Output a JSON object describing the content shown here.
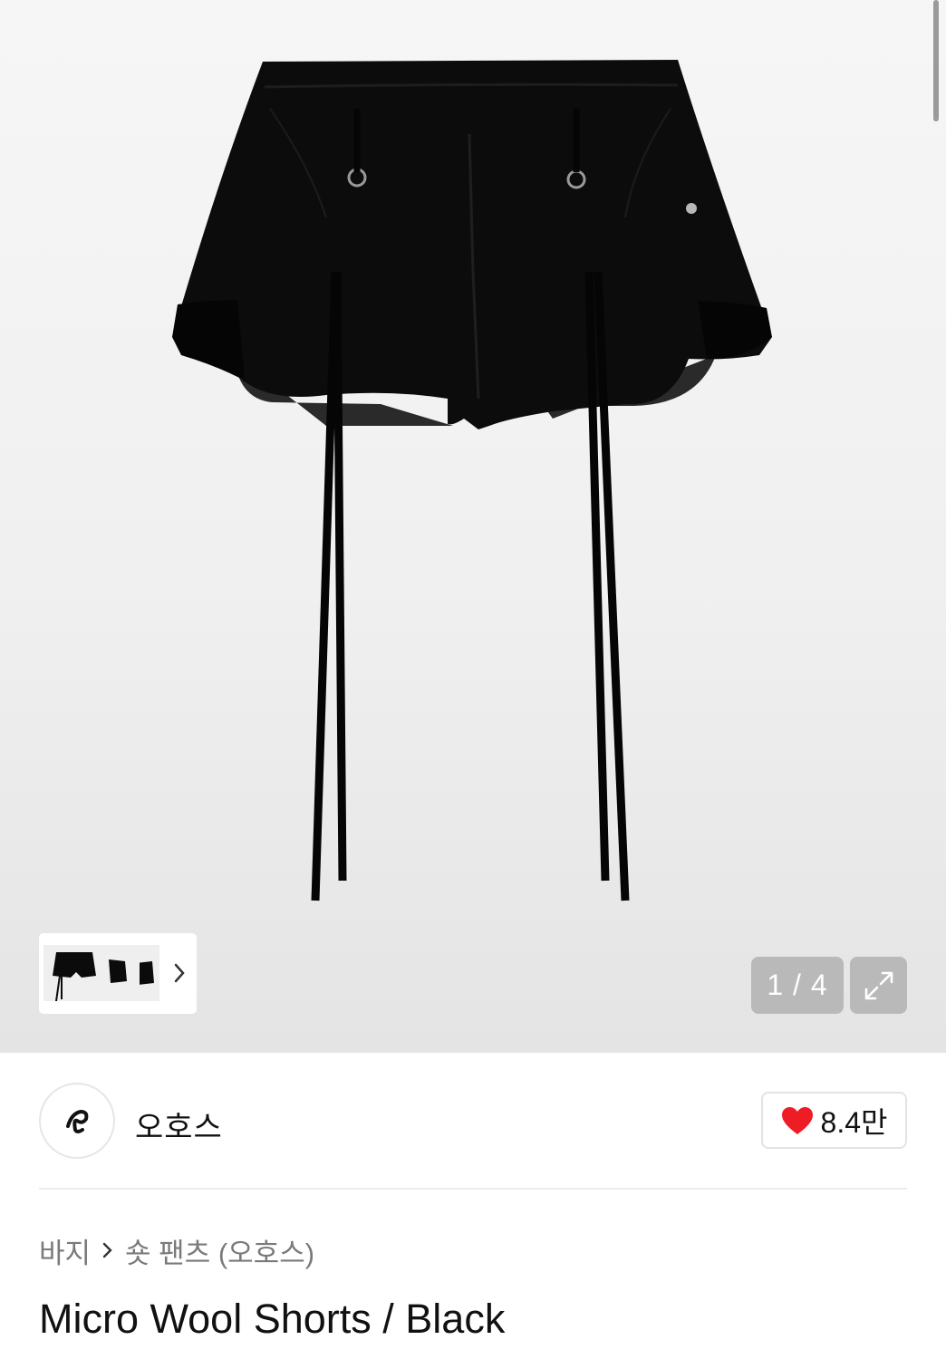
{
  "gallery": {
    "image_alt": "Micro Wool Shorts / Black",
    "counter": "1 / 4",
    "thumbnails": [
      "thumbnail-1",
      "thumbnail-2",
      "thumbnail-3"
    ],
    "icons": {
      "next": "chevron-right-icon",
      "expand": "expand-icon"
    }
  },
  "brand": {
    "name": "오호스",
    "likes": "8.4만",
    "like_color": "#ee1c25"
  },
  "breadcrumb": {
    "category": "바지",
    "subcategory": "숏 팬츠 (오호스)"
  },
  "product": {
    "title": "Micro Wool Shorts / Black"
  }
}
